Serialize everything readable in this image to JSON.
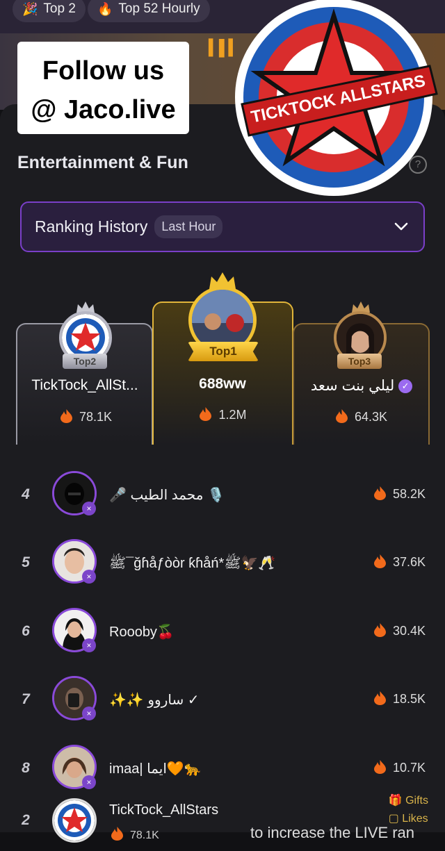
{
  "header": {
    "tabs": [
      {
        "label": "Top 2",
        "icon": "party-icon"
      },
      {
        "label": "Top 52 Hourly",
        "icon": "fire-icon"
      }
    ]
  },
  "overlay": {
    "follow_line1": "Follow  us",
    "follow_line2": "@ Jaco.live",
    "logo_text": "TICKTOCK ALLSTARS"
  },
  "category": {
    "title": "Entertainment & Fun",
    "help_icon": "question-icon"
  },
  "dropdown": {
    "label": "Ranking History",
    "badge": "Last Hour",
    "icon": "chevron-down-icon"
  },
  "podium": [
    {
      "position": 2,
      "badge": "Top2",
      "name": "TickTock_AllSt...",
      "score": "78.1K",
      "verified": false
    },
    {
      "position": 1,
      "badge": "Top1",
      "name": "688ww",
      "score": "1.2M",
      "verified": false
    },
    {
      "position": 3,
      "badge": "Top3",
      "name": "ليلي بنت سعد",
      "score": "64.3K",
      "verified": true
    }
  ],
  "ranking": [
    {
      "rank": "4",
      "name": "🎤 محمد الطيب 🎙️",
      "score": "58.2K"
    },
    {
      "rank": "5",
      "name": "ﷺ¯ğɦåƒòòr ƙɦåń*ﷺ🦅🥂",
      "score": "37.6K"
    },
    {
      "rank": "6",
      "name": "Roooby🍒",
      "score": "30.4K"
    },
    {
      "rank": "7",
      "name": "✨✨ ساروو ✓",
      "score": "18.5K"
    },
    {
      "rank": "8",
      "name": "imaa| ايما🧡🐆",
      "score": "10.7K"
    }
  ],
  "self_row": {
    "rank": "2",
    "name": "TickTock_AllStars",
    "score": "78.1K"
  },
  "bottom": {
    "gifts": "Gifts",
    "likes": "Likes",
    "caption": "to increase the LIVE ran"
  },
  "colors": {
    "accent": "#7a3fc9",
    "gold": "#e1b53a",
    "flame": "#f26a1b"
  }
}
